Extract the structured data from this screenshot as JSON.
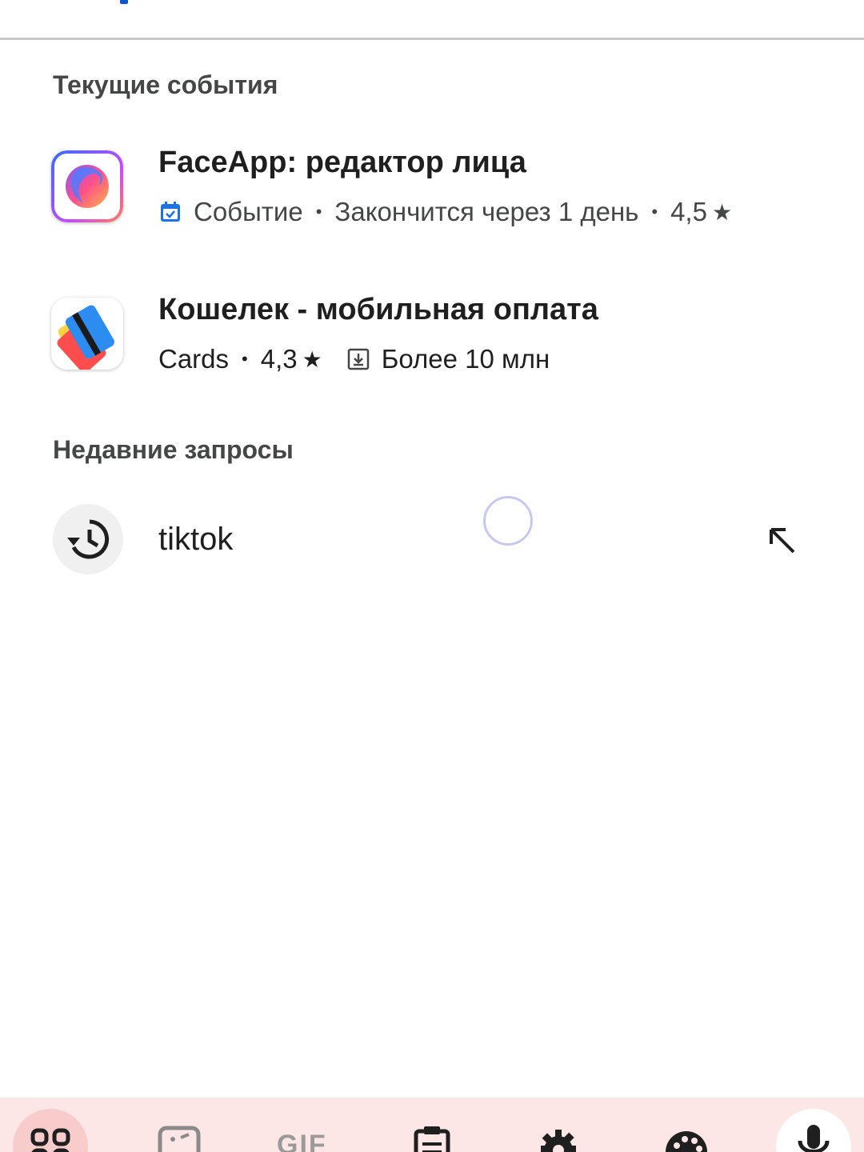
{
  "sections": {
    "current_events": "Текущие события",
    "recent_queries": "Недавние запросы"
  },
  "apps": [
    {
      "title": "FaceApp: редактор лица",
      "tag": "Событие",
      "status": "Закончится через 1 день",
      "rating": "4,5",
      "icon": "faceapp-icon"
    },
    {
      "title": "Кошелек - мобильная оплата",
      "category": "Cards",
      "rating": "4,3",
      "downloads": "Более 10 млн",
      "icon": "wallet-cards-icon"
    }
  ],
  "recent": [
    {
      "query": "tiktok",
      "icon": "history-icon"
    }
  ],
  "keyboard_toolbar": {
    "items": [
      "apps-grid-icon",
      "sticker-icon",
      "gif-icon",
      "clipboard-icon",
      "gear-icon",
      "palette-icon",
      "mic-icon"
    ],
    "gif_label": "GIF"
  },
  "colors": {
    "accent": "#0b57d0",
    "event_icon": "#1a73e8",
    "toolbar_bg": "#fde6e6"
  }
}
